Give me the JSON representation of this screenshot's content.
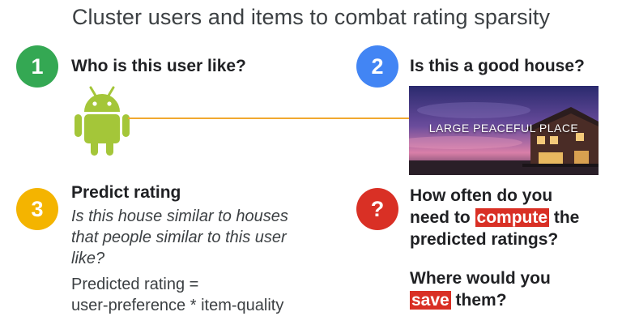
{
  "title": "Cluster users and items to combat rating sparsity",
  "colors": {
    "green": "#34a853",
    "blue": "#4285f4",
    "yellow": "#f4b400",
    "red": "#d93025",
    "android": "#a4c639",
    "connector": "#f0a830"
  },
  "section1": {
    "number": "1",
    "heading": "Who is this user like?",
    "icon": "android-icon"
  },
  "section2": {
    "number": "2",
    "heading": "Is this a good house?",
    "image_caption": "LARGE PEACEFUL PLACE"
  },
  "section3": {
    "number": "3",
    "heading": "Predict rating",
    "italic_lines": [
      "Is this house similar to houses",
      "that people similar to this user",
      "like?"
    ],
    "formula_lines": [
      "Predicted rating =",
      "user-preference * item-quality"
    ]
  },
  "section4": {
    "number": "?",
    "q1_line1": "How often do you",
    "q1_pre": "need to ",
    "q1_highlight": "compute",
    "q1_post": " the",
    "q1_line3": "predicted ratings?",
    "q2_line1": "Where would you",
    "q2_highlight": "save",
    "q2_post": " them?"
  }
}
